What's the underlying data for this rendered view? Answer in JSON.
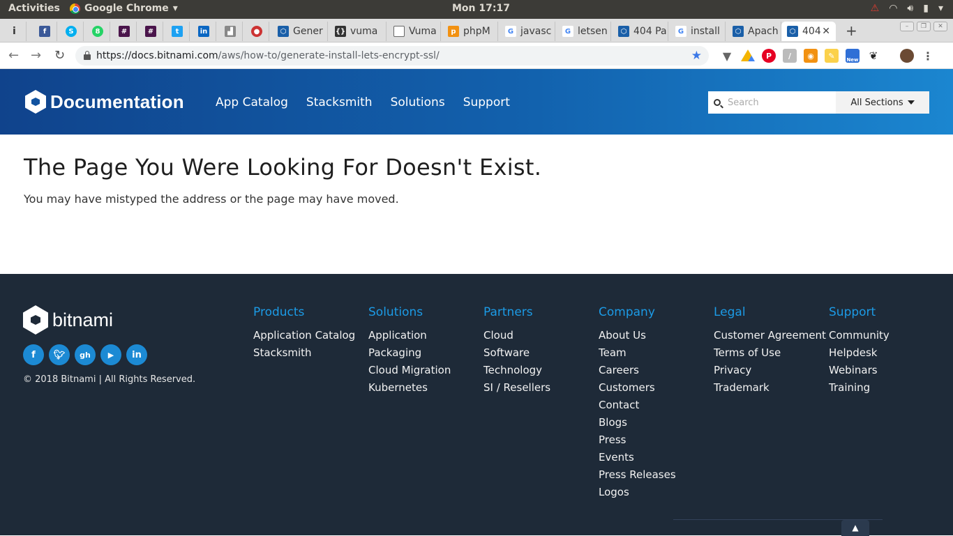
{
  "os": {
    "activities": "Activities",
    "app_name": "Google Chrome",
    "clock": "Mon 17:17"
  },
  "tabs": [
    {
      "label": "Gener",
      "icon": "bitnami-icon"
    },
    {
      "label": "vuma",
      "icon": "code-braces-icon"
    },
    {
      "label": "Vuma",
      "icon": "document-icon"
    },
    {
      "label": "phpM",
      "icon": "phpmyadmin-icon"
    },
    {
      "label": "javasc",
      "icon": "google-icon"
    },
    {
      "label": "letsen",
      "icon": "google-icon"
    },
    {
      "label": "404 Pa",
      "icon": "bitnami-icon"
    },
    {
      "label": "install",
      "icon": "google-icon"
    },
    {
      "label": "Apach",
      "icon": "bitnami-icon"
    },
    {
      "label": "404",
      "icon": "bitnami-icon"
    }
  ],
  "address": {
    "host": "https://docs.bitnami.com",
    "path": "/aws/how-to/generate-install-lets-encrypt-ssl/"
  },
  "header": {
    "logo_text": "Documentation",
    "nav": [
      "App Catalog",
      "Stacksmith",
      "Solutions",
      "Support"
    ],
    "search_placeholder": "Search",
    "sections_label": "All Sections"
  },
  "content": {
    "title": "The Page You Were Looking For Doesn't Exist.",
    "message": "You may have mistyped the address or the page may have moved."
  },
  "footer": {
    "brand": "bitnami",
    "social": [
      "f",
      "t",
      "gh",
      "yt",
      "in"
    ],
    "copyright": "© 2018 Bitnami | All Rights Reserved.",
    "columns": [
      {
        "title": "Products",
        "links": [
          "Application Catalog",
          "Stacksmith"
        ]
      },
      {
        "title": "Solutions",
        "links": [
          "Application",
          "Packaging",
          "Cloud Migration",
          "Kubernetes"
        ]
      },
      {
        "title": "Partners",
        "links": [
          "Cloud",
          "Software",
          "Technology",
          "SI / Resellers"
        ]
      },
      {
        "title": "Company",
        "links": [
          "About Us",
          "Team",
          "Careers",
          "Customers",
          "Contact",
          "Blogs",
          "Press",
          "Events",
          "Press Releases",
          "Logos"
        ]
      },
      {
        "title": "Legal",
        "links": [
          "Customer Agreement",
          "Terms of Use",
          "Privacy",
          "Trademark"
        ]
      },
      {
        "title": "Support",
        "links": [
          "Community",
          "Helpdesk",
          "Webinars",
          "Training"
        ]
      }
    ]
  },
  "colors": {
    "header_start": "#10438c",
    "header_end": "#1b86d0",
    "footer_bg": "#1e2a38",
    "footer_heading": "#1c9be6"
  }
}
